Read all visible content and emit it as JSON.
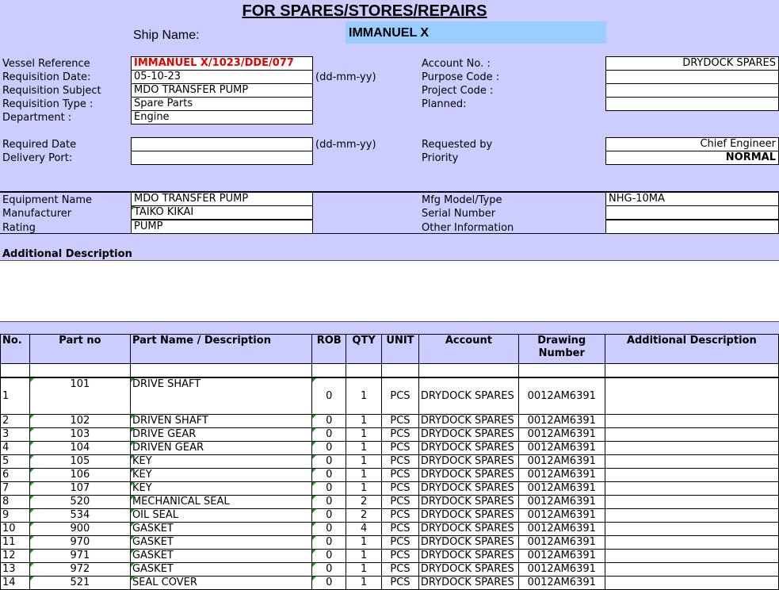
{
  "header": {
    "title": "FOR SPARES/STORES/REPAIRS",
    "ship_name_label": "Ship Name:",
    "ship_name": "IMMANUEL X"
  },
  "left_fields": {
    "vessel_reference_label": "Vessel Reference",
    "vessel_reference": "IMMANUEL X/1023/DDE/077",
    "requisition_date_label": "Requisition Date:",
    "requisition_date": "05-10-23",
    "date_format_hint": "(dd-mm-yy)",
    "requisition_subject_label": "Requisition Subject",
    "requisition_subject": "MDO TRANSFER PUMP",
    "requisition_type_label": "Requisition Type :",
    "requisition_type": "Spare Parts",
    "department_label": "Department :",
    "department": "Engine",
    "required_date_label": "Required Date",
    "required_date": "",
    "required_date_hint": "(dd-mm-yy)",
    "delivery_port_label": "Delivery Port:",
    "delivery_port": ""
  },
  "right_fields": {
    "account_no_label": "Account No. :",
    "account_no": "DRYDOCK SPARES",
    "purpose_code_label": "Purpose Code :",
    "purpose_code": "",
    "project_code_label": "Project Code :",
    "project_code": "",
    "planned_label": "Planned:",
    "planned": "",
    "requested_by_label": "Requested by",
    "requested_by": "Chief Engineer",
    "priority_label": "Priority",
    "priority": "NORMAL"
  },
  "equipment": {
    "name_label": "Equipment Name",
    "name": "MDO TRANSFER PUMP",
    "manufacturer_label": "Manufacturer",
    "manufacturer": "TAIKO KIKAI",
    "rating_label": "Rating",
    "rating": "PUMP",
    "model_label": "Mfg Model/Type",
    "model": "NHG-10MA",
    "serial_label": "Serial Number",
    "serial": "",
    "other_label": "Other Information",
    "other": ""
  },
  "additional_description_label": "Additional Description",
  "table": {
    "headers": {
      "no": "No.",
      "part_no": "Part no",
      "part_name": "Part Name / Description",
      "rob": "ROB",
      "qty": "QTY",
      "unit": "UNIT",
      "account": "Account",
      "drawing": "Drawing Number",
      "additional": "Additional Description"
    },
    "rows": [
      {
        "no": "1",
        "part_no": "101",
        "name": "DRIVE SHAFT",
        "rob": "0",
        "qty": "1",
        "unit": "PCS",
        "account": "DRYDOCK SPARES",
        "drawing": "0012AM6391",
        "additional": ""
      },
      {
        "no": "2",
        "part_no": "102",
        "name": "DRIVEN SHAFT",
        "rob": "0",
        "qty": "1",
        "unit": "PCS",
        "account": "DRYDOCK SPARES",
        "drawing": "0012AM6391",
        "additional": ""
      },
      {
        "no": "3",
        "part_no": "103",
        "name": "DRIVE GEAR",
        "rob": "0",
        "qty": "1",
        "unit": "PCS",
        "account": "DRYDOCK SPARES",
        "drawing": "0012AM6391",
        "additional": ""
      },
      {
        "no": "4",
        "part_no": "104",
        "name": "DRIVEN GEAR",
        "rob": "0",
        "qty": "1",
        "unit": "PCS",
        "account": "DRYDOCK SPARES",
        "drawing": "0012AM6391",
        "additional": ""
      },
      {
        "no": "5",
        "part_no": "105",
        "name": "KEY",
        "rob": "0",
        "qty": "1",
        "unit": "PCS",
        "account": "DRYDOCK SPARES",
        "drawing": "0012AM6391",
        "additional": ""
      },
      {
        "no": "6",
        "part_no": "106",
        "name": "KEY",
        "rob": "0",
        "qty": "1",
        "unit": "PCS",
        "account": "DRYDOCK SPARES",
        "drawing": "0012AM6391",
        "additional": ""
      },
      {
        "no": "7",
        "part_no": "107",
        "name": "KEY",
        "rob": "0",
        "qty": "1",
        "unit": "PCS",
        "account": "DRYDOCK SPARES",
        "drawing": "0012AM6391",
        "additional": ""
      },
      {
        "no": "8",
        "part_no": "520",
        "name": "MECHANICAL SEAL",
        "rob": "0",
        "qty": "2",
        "unit": "PCS",
        "account": "DRYDOCK SPARES",
        "drawing": "0012AM6391",
        "additional": ""
      },
      {
        "no": "9",
        "part_no": "534",
        "name": "OIL SEAL",
        "rob": "0",
        "qty": "2",
        "unit": "PCS",
        "account": "DRYDOCK SPARES",
        "drawing": "0012AM6391",
        "additional": ""
      },
      {
        "no": "10",
        "part_no": "900",
        "name": "GASKET",
        "rob": "0",
        "qty": "4",
        "unit": "PCS",
        "account": "DRYDOCK SPARES",
        "drawing": "0012AM6391",
        "additional": ""
      },
      {
        "no": "11",
        "part_no": "970",
        "name": "GASKET",
        "rob": "0",
        "qty": "1",
        "unit": "PCS",
        "account": "DRYDOCK SPARES",
        "drawing": "0012AM6391",
        "additional": ""
      },
      {
        "no": "12",
        "part_no": "971",
        "name": "GASKET",
        "rob": "0",
        "qty": "1",
        "unit": "PCS",
        "account": "DRYDOCK SPARES",
        "drawing": "0012AM6391",
        "additional": ""
      },
      {
        "no": "13",
        "part_no": "972",
        "name": "GASKET",
        "rob": "0",
        "qty": "1",
        "unit": "PCS",
        "account": "DRYDOCK SPARES",
        "drawing": "0012AM6391",
        "additional": ""
      },
      {
        "no": "14",
        "part_no": "521",
        "name": "SEAL COVER",
        "rob": "0",
        "qty": "1",
        "unit": "PCS",
        "account": "DRYDOCK SPARES",
        "drawing": "0012AM6391",
        "additional": ""
      }
    ]
  },
  "colors": {
    "background": "#ccccff",
    "ship_name_fill": "#99ccff",
    "reference_text": "#e60000"
  }
}
